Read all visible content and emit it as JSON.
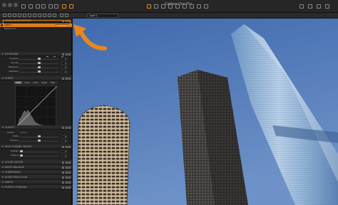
{
  "window": {
    "title": "Capture One Pro"
  },
  "toolbar": {
    "layer_select": "Layer 1"
  },
  "panel": {
    "local_adjustments_title": "LOCAL ADJUSTMENTS",
    "layers": [
      {
        "name": "Layer 1"
      },
      {
        "name": "Background"
      }
    ],
    "exposure": {
      "title": "EXPOSURE",
      "sliders": [
        {
          "label": "Exposure",
          "value": "0",
          "knob": 0.5
        },
        {
          "label": "Contrast",
          "value": "0",
          "knob": 0.5
        },
        {
          "label": "Brightness",
          "value": "0",
          "knob": 0.5
        },
        {
          "label": "Saturation",
          "value": "0",
          "knob": 0.5
        }
      ]
    },
    "curve": {
      "title": "CURVE",
      "tabs": [
        "RGB",
        "Luma",
        "Red",
        "Green",
        "Blue"
      ],
      "active_tab": "RGB",
      "input_label": "Input:",
      "output_label": "Output:"
    },
    "clarity": {
      "title": "CLARITY",
      "method_label": "Method",
      "method_value": "Natural",
      "sliders": [
        {
          "label": "Clarity",
          "value": "0",
          "knob": 0.5
        },
        {
          "label": "Structure",
          "value": "0",
          "knob": 0.5
        }
      ]
    },
    "hdr": {
      "title": "HIGH DYNAMIC RANGE",
      "sliders": [
        {
          "label": "Highlight",
          "value": "0",
          "knob": 0.05
        },
        {
          "label": "Shadow",
          "value": "0",
          "knob": 0.05
        }
      ]
    },
    "collapsed_sections": [
      "COLOR EDITOR",
      "WHITE BALANCE",
      "SHARPENING",
      "NOISE REDUCTION",
      "MOIRE",
      "PURPLE FRINGING"
    ]
  },
  "colors": {
    "accent": "#e07f1f",
    "sky": "#4f79b7",
    "panel": "#222222"
  }
}
